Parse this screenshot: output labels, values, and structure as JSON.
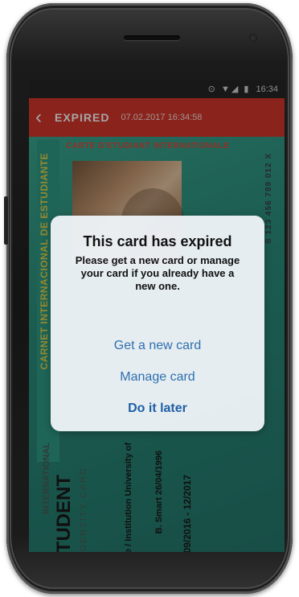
{
  "status_bar": {
    "icons": "⊙ ▼◢ ▮",
    "time": "16:34"
  },
  "app_bar": {
    "back_icon": "chevron-left",
    "title": "EXPIRED",
    "subtitle": "07.02.2017 16:34:58"
  },
  "card": {
    "side_text": "CARNET INTERNACIONAL DE ESTUDIANTE",
    "top_text": "CARTE D'ÉTUDIANT INTERNATIONALE",
    "id_text": "S 123 456 789 012 X",
    "intl_text": "INTERNATIONAL",
    "student_text": "STUDENT",
    "identity_text": "IDENTITY CARD",
    "univ_lines": "Name / Institution\nUniversity of",
    "name_lines": "B. Smart\n26/04/1996",
    "validity": "09/2016 - 12/2017"
  },
  "dialog": {
    "title": "This card has expired",
    "message": "Please get a new card or manage your card if you already have a new one.",
    "get_new_card": "Get a new card",
    "manage_card": "Manage card",
    "do_it_later": "Do it later"
  },
  "colors": {
    "app_bar": "#d4362b",
    "card_bg": "#2d8f7d",
    "dialog_bg": "#ecf2f6",
    "link": "#2f6fb0"
  }
}
